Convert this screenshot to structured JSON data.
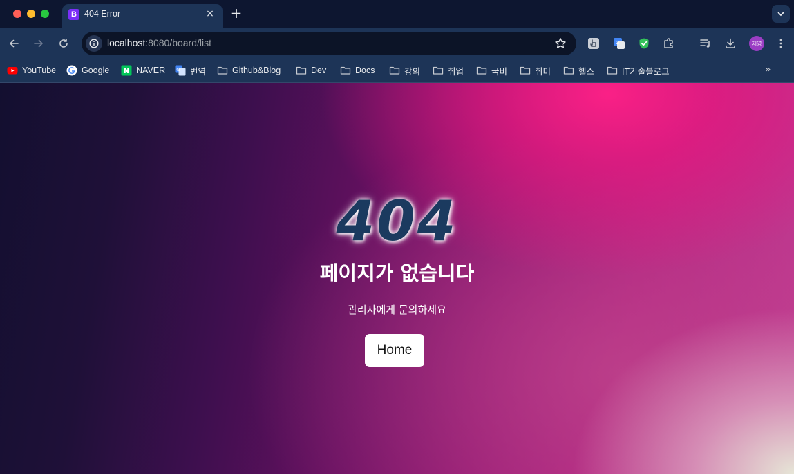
{
  "browser": {
    "tab": {
      "favicon_letter": "B",
      "title": "404 Error",
      "close_glyph": "×"
    },
    "new_tab_glyph": "+",
    "address_bar": {
      "host": "localhost",
      "rest": ":8080/board/list"
    },
    "profile_avatar": "재영",
    "bookmarks": [
      {
        "label": "YouTube",
        "icon": "youtube-icon"
      },
      {
        "label": "Google",
        "icon": "google-icon"
      },
      {
        "label": "NAVER",
        "icon": "naver-icon"
      },
      {
        "label": "번역",
        "icon": "translate-icon"
      },
      {
        "label": "Github&Blog",
        "icon": "folder-icon"
      },
      {
        "label": "Dev",
        "icon": "folder-icon"
      },
      {
        "label": "Docs",
        "icon": "folder-icon"
      },
      {
        "label": "강의",
        "icon": "folder-icon"
      },
      {
        "label": "취업",
        "icon": "folder-icon"
      },
      {
        "label": "국비",
        "icon": "folder-icon"
      },
      {
        "label": "취미",
        "icon": "folder-icon"
      },
      {
        "label": "헬스",
        "icon": "folder-icon"
      },
      {
        "label": "IT기술블로그",
        "icon": "folder-icon"
      }
    ],
    "bookmarks_overflow_glyph": "»"
  },
  "page": {
    "code": "404",
    "title": "페이지가 없습니다",
    "message": "관리자에게 문의하세요",
    "home_button": "Home"
  },
  "colors": {
    "browser_chrome": "#1d3457",
    "tab_strip": "#0d1630",
    "heading_404": "#1b3a5f",
    "gradient_pink": "#fa2086",
    "gradient_dark": "#130f30"
  }
}
